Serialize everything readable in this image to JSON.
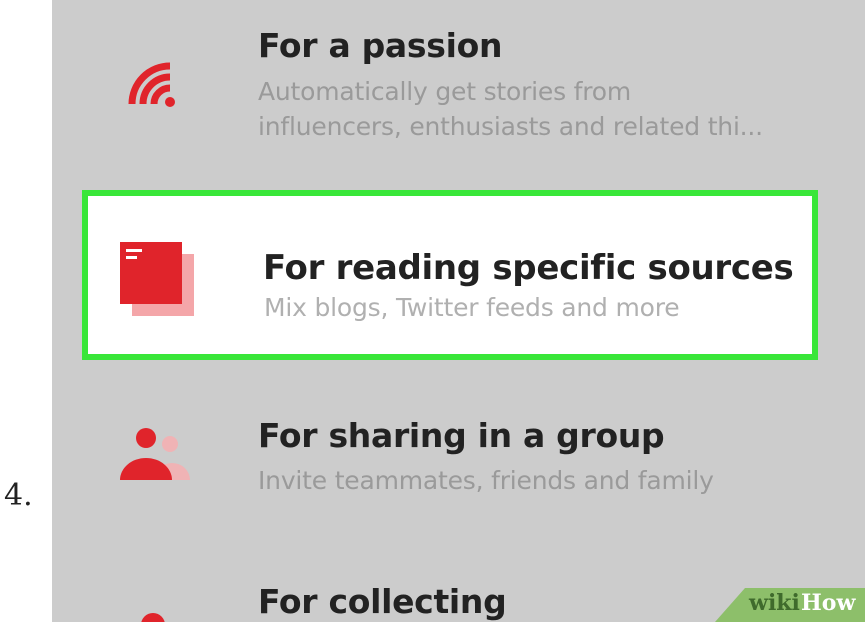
{
  "step_number": "4.",
  "colors": {
    "accent": "#e0242b",
    "highlight": "#39e639",
    "background": "#cccccc"
  },
  "options": [
    {
      "title": "For a passion",
      "description_line1": "Automatically get stories from",
      "description_line2": "influencers, enthusiasts and related thi...",
      "icon": "feed-icon"
    },
    {
      "title": "For reading specific sources",
      "description": "Mix blogs, Twitter feeds and more",
      "icon": "stacked-pages-icon"
    },
    {
      "title": "For sharing in a group",
      "description": "Invite teammates, friends and family",
      "icon": "people-icon"
    },
    {
      "title": "For collecting",
      "icon": "pin-icon"
    }
  ],
  "watermark": {
    "part1": "wiki",
    "part2": "How"
  }
}
